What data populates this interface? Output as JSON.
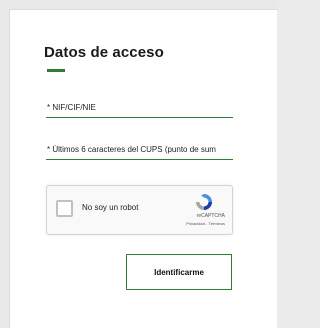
{
  "login": {
    "title": "Datos de acceso",
    "nif_label": "* NIF/CIF/NIE",
    "cups_label": "* Últimos 6 caracteres del CUPS (punto de sum",
    "submit_label": "Identificarme"
  },
  "captcha": {
    "label": "No soy un robot",
    "brand": "reCAPTCHA",
    "terms": "Privacidad - Términos"
  },
  "colors": {
    "accent": "#2e7d32"
  },
  "icons": {
    "captcha_logo": "recaptcha-logo-icon",
    "checkbox": "checkbox-icon"
  }
}
